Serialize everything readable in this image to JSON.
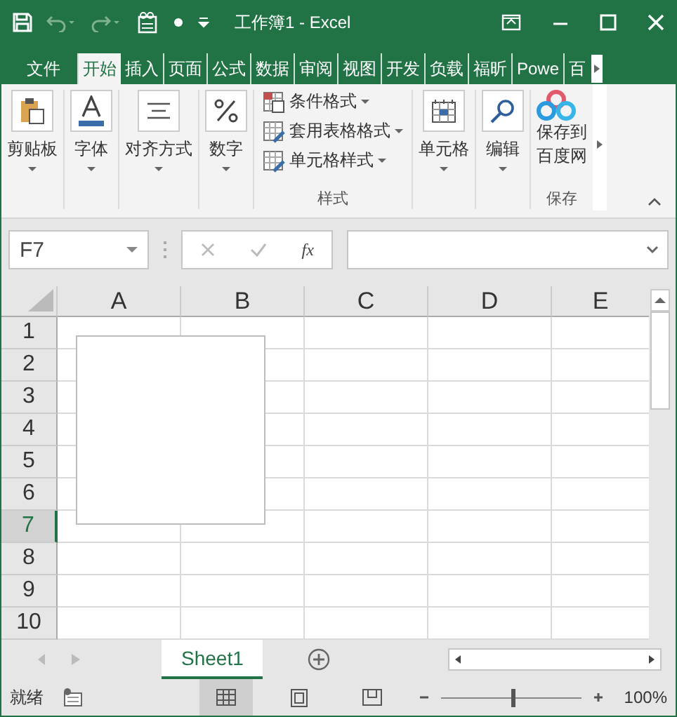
{
  "window": {
    "title": "工作簿1 - Excel"
  },
  "tabs": [
    {
      "label": "文件",
      "selected": false
    },
    {
      "label": "开始",
      "selected": true
    },
    {
      "label": "插入",
      "selected": false
    },
    {
      "label": "页面",
      "selected": false
    },
    {
      "label": "公式",
      "selected": false
    },
    {
      "label": "数据",
      "selected": false
    },
    {
      "label": "审阅",
      "selected": false
    },
    {
      "label": "视图",
      "selected": false
    },
    {
      "label": "开发",
      "selected": false
    },
    {
      "label": "负载",
      "selected": false
    },
    {
      "label": "福昕",
      "selected": false
    },
    {
      "label": "Powe",
      "selected": false
    },
    {
      "label": "百",
      "selected": false
    }
  ],
  "ribbon": {
    "groups": [
      {
        "kind": "big",
        "label": "剪贴板"
      },
      {
        "kind": "big",
        "label": "字体"
      },
      {
        "kind": "big",
        "label": "对齐方式"
      },
      {
        "kind": "big",
        "label": "数字"
      },
      {
        "kind": "styles",
        "items": [
          "条件格式",
          "套用表格格式",
          "单元格样式"
        ],
        "group_label": "样式"
      },
      {
        "kind": "big",
        "label": "单元格"
      },
      {
        "kind": "big",
        "label": "编辑"
      },
      {
        "kind": "cloud",
        "lines": [
          "保存到",
          "百度网"
        ],
        "group_label": "保存"
      }
    ]
  },
  "formula_bar": {
    "name_box": "F7",
    "fx": "fx"
  },
  "grid": {
    "columns": [
      "A",
      "B",
      "C",
      "D",
      "E"
    ],
    "rows": [
      {
        "label": "1",
        "selected": false
      },
      {
        "label": "2",
        "selected": false
      },
      {
        "label": "3",
        "selected": false
      },
      {
        "label": "4",
        "selected": false
      },
      {
        "label": "5",
        "selected": false
      },
      {
        "label": "6",
        "selected": false
      },
      {
        "label": "7",
        "selected": true
      },
      {
        "label": "8",
        "selected": false
      },
      {
        "label": "9",
        "selected": false
      },
      {
        "label": "10",
        "selected": false
      }
    ]
  },
  "sheet_tabs": [
    {
      "label": "Sheet1",
      "selected": true
    }
  ],
  "status_bar": {
    "status": "就绪",
    "views": [
      {
        "kind": "normal",
        "selected": true
      },
      {
        "kind": "layout",
        "selected": false
      },
      {
        "kind": "pagebreak",
        "selected": false
      }
    ],
    "zoom": {
      "level": 0.5,
      "reading": "100%"
    }
  }
}
